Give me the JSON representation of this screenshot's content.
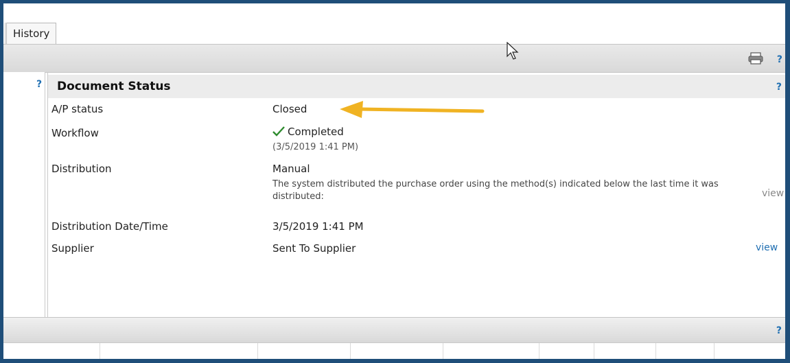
{
  "tabs": {
    "history_label": "History"
  },
  "toolbar": {
    "help": "?",
    "print_icon": "printer-icon"
  },
  "panel": {
    "left_help": "?",
    "title": "Document Status",
    "title_help": "?"
  },
  "fields": {
    "ap_status_label": "A/P status",
    "ap_status_value": "Closed",
    "workflow_label": "Workflow",
    "workflow_value": "Completed",
    "workflow_time": "(3/5/2019 1:41 PM)",
    "distribution_label": "Distribution",
    "distribution_value": "Manual",
    "distribution_note": "The system distributed the purchase order using the method(s) indicated below the last time it was distributed:",
    "distribution_view": "view",
    "distribution_datetime_label": "Distribution Date/Time",
    "distribution_datetime_value": "3/5/2019 1:41 PM",
    "supplier_label": "Supplier",
    "supplier_value": "Sent To Supplier",
    "supplier_view": "view"
  },
  "bottom": {
    "help": "?"
  },
  "colors": {
    "frame": "#1f4e79",
    "link": "#1f6fb2",
    "arrow": "#f0b323",
    "check": "#2e8b2e"
  }
}
